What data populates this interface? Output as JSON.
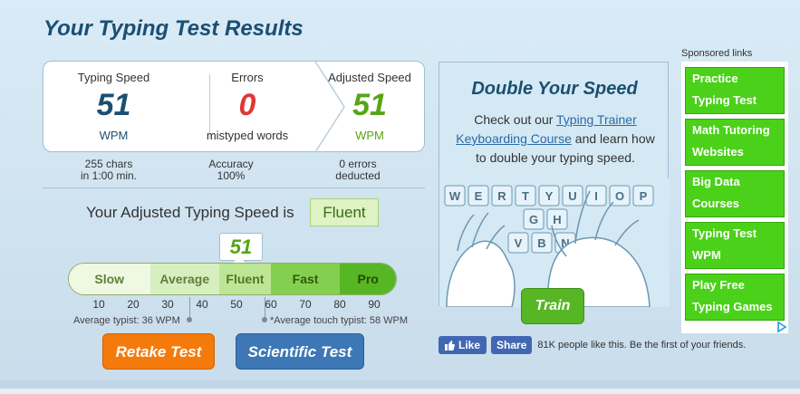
{
  "title": "Your Typing Test Results",
  "stats": {
    "typing_speed": {
      "label": "Typing Speed",
      "value": "51",
      "unit": "WPM",
      "sub1": "255 chars",
      "sub2": "in 1:00 min.",
      "color": "#1b4f72"
    },
    "errors": {
      "label": "Errors",
      "value": "0",
      "unit": "mistyped words",
      "sub1": "Accuracy",
      "sub2": "100%",
      "color": "#e03636"
    },
    "adjusted": {
      "label": "Adjusted Speed",
      "value": "51",
      "unit": "WPM",
      "sub1": "0 errors",
      "sub2": "deducted",
      "color": "#56a515"
    }
  },
  "adjusted_line": {
    "text": "Your Adjusted Typing Speed is",
    "level": "Fluent"
  },
  "scale": {
    "marker_value": "51",
    "segments": [
      "Slow",
      "Average",
      "Fluent",
      "Fast",
      "Pro"
    ],
    "ticks": [
      "10",
      "20",
      "30",
      "40",
      "50",
      "60",
      "70",
      "80",
      "90"
    ],
    "average_note": "Average typist: 36 WPM",
    "touch_note": "*Average touch typist: 58 WPM"
  },
  "buttons": {
    "retake": "Retake Test",
    "scientific": "Scientific Test",
    "train": "Train"
  },
  "promo": {
    "title": "Double Your Speed",
    "text_before": "Check out our ",
    "link1": "Typing Trainer",
    "link2": "Keyboarding Course",
    "text_after": " and learn how to double your typing speed.",
    "keys_row1": [
      "W",
      "E",
      "R",
      "T",
      "Y",
      "U",
      "I",
      "O",
      "P"
    ],
    "keys_row2": [
      "G",
      "H"
    ],
    "keys_row3": [
      "V",
      "B",
      "N"
    ]
  },
  "social": {
    "like": "Like",
    "share": "Share",
    "text": "81K people like this. Be the first of your friends."
  },
  "ads": {
    "label": "Sponsored links",
    "items": [
      "Practice Typing Test",
      "Math Tutoring Websites",
      "Big Data Courses",
      "Typing Test WPM",
      "Play Free Typing Games"
    ]
  }
}
